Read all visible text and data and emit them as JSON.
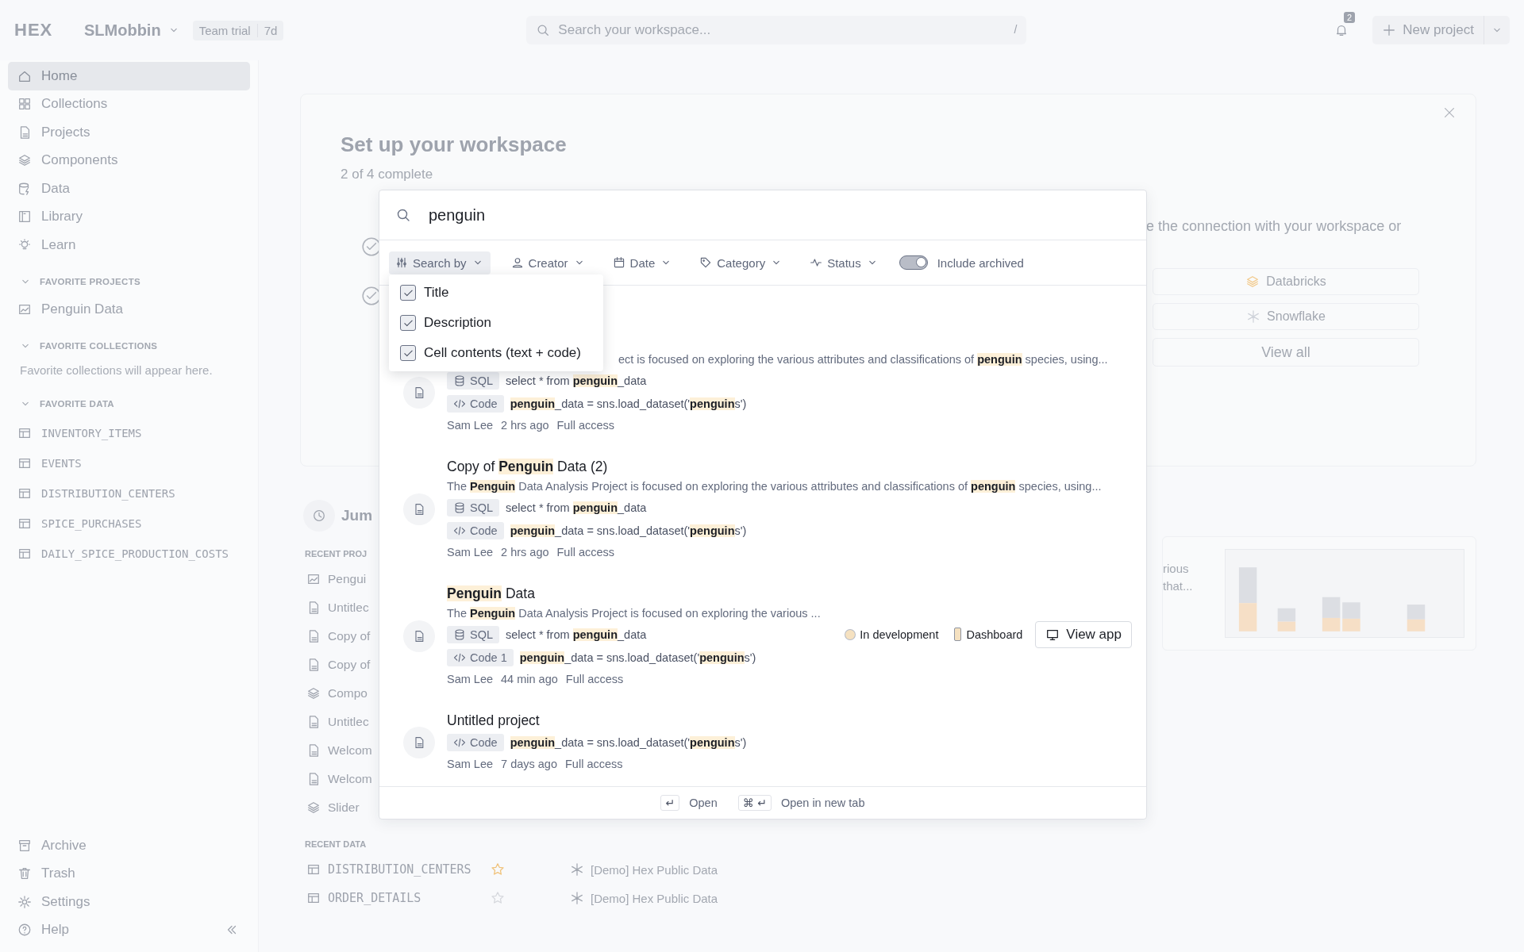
{
  "topbar": {
    "logo": "HEX",
    "workspace": "SLMobbin",
    "plan": "Team trial",
    "plan_days": "7d",
    "search_placeholder": "Search your workspace...",
    "search_shortcut": "/",
    "notifications": "2",
    "new_project": "New project"
  },
  "sidebar": {
    "items": [
      {
        "label": "Home",
        "kind": "home",
        "selected": true
      },
      {
        "label": "Collections",
        "kind": "grid",
        "selected": false
      },
      {
        "label": "Projects",
        "kind": "file",
        "selected": false
      },
      {
        "label": "Components",
        "kind": "layers",
        "selected": false
      },
      {
        "label": "Data",
        "kind": "data",
        "selected": false
      },
      {
        "label": "Library",
        "kind": "book",
        "selected": false
      },
      {
        "label": "Learn",
        "kind": "bulb",
        "selected": false
      }
    ],
    "sections": [
      {
        "title": "FAVORITE PROJECTS",
        "kind": "project",
        "items": [
          {
            "label": "Penguin Data",
            "kind": "chart"
          }
        ]
      },
      {
        "title": "FAVORITE COLLECTIONS",
        "kind": "empty",
        "note": "Favorite collections will appear here."
      },
      {
        "title": "FAVORITE DATA",
        "kind": "data",
        "items": [
          {
            "label": "INVENTORY_ITEMS",
            "kind": "table"
          },
          {
            "label": "EVENTS",
            "kind": "table"
          },
          {
            "label": "DISTRIBUTION_CENTERS",
            "kind": "table"
          },
          {
            "label": "SPICE_PURCHASES",
            "kind": "table"
          },
          {
            "label": "DAILY_SPICE_PRODUCTION_COSTS",
            "kind": "table"
          }
        ]
      }
    ],
    "bottom": [
      {
        "label": "Archive",
        "kind": "archive"
      },
      {
        "label": "Trash",
        "kind": "trash"
      },
      {
        "label": "Settings",
        "kind": "gear"
      },
      {
        "label": "Help",
        "kind": "help"
      }
    ]
  },
  "setup": {
    "title": "Set up your workspace",
    "progress": "2 of 4 complete",
    "steps": [
      {
        "done": true
      },
      {
        "done": true
      }
    ],
    "connection_text": "e the connection with your workspace or",
    "buttons": [
      {
        "label": "Databricks",
        "kind": "layers",
        "color": "#f2c98a"
      },
      {
        "label": "Snowflake",
        "kind": "snowflake",
        "color": "#cfd3da"
      },
      {
        "label": "View all"
      }
    ]
  },
  "jump": {
    "title": "Jum",
    "recent_projects_label": "RECENT PROJ",
    "recent_projects": [
      {
        "label": "Pengui",
        "kind": "chart"
      },
      {
        "label": "Untitlec",
        "kind": "file"
      },
      {
        "label": "Copy of",
        "kind": "file"
      },
      {
        "label": "Copy of",
        "kind": "file"
      },
      {
        "label": "Compo",
        "kind": "layers"
      },
      {
        "label": "Untitlec",
        "kind": "file"
      },
      {
        "label": "Welcom",
        "kind": "file"
      },
      {
        "label": "Welcom",
        "kind": "file"
      },
      {
        "label": "Slider",
        "kind": "layers"
      }
    ],
    "recent_data_label": "RECENT DATA",
    "recent_data": [
      {
        "name": "DISTRIBUTION_CENTERS",
        "starred": true,
        "source": "[Demo] Hex Public Data"
      },
      {
        "name": "ORDER_DETAILS",
        "starred": false,
        "source": "[Demo] Hex Public Data"
      }
    ],
    "preview_text": [
      "rious",
      "that..."
    ]
  },
  "modal": {
    "query": "penguin",
    "filters": [
      {
        "label": "Search by",
        "kind": "sliders",
        "selected": true
      },
      {
        "label": "Creator",
        "kind": "user",
        "selected": false
      },
      {
        "label": "Date",
        "kind": "calendar",
        "selected": false
      },
      {
        "label": "Category",
        "kind": "tag",
        "selected": false
      },
      {
        "label": "Status",
        "kind": "pulse",
        "selected": false
      }
    ],
    "toggle": {
      "label": "Include archived",
      "on": true
    },
    "menu": [
      {
        "label": "Title",
        "checked": true
      },
      {
        "label": "Description",
        "checked": true
      },
      {
        "label": "Cell contents (text + code)",
        "checked": true
      }
    ],
    "results": [
      {
        "clipped": true,
        "description": "ect is focused on exploring the various attributes and classifications of **penguin** species, using...",
        "snippets": [
          {
            "kind": "sql",
            "tag": "SQL",
            "text": "select * from **penguin**_data"
          },
          {
            "kind": "code",
            "tag": "Code",
            "text": "**penguin**_data = sns.load_dataset('**penguin**s')"
          }
        ],
        "author": "Sam Lee",
        "time": "2 hrs ago",
        "access": "Full access"
      },
      {
        "clipped": false,
        "title": "Copy of **Penguin** Data (2)",
        "description": "The **Penguin** Data Analysis Project is focused on exploring the various attributes and classifications of **penguin** species, using...",
        "snippets": [
          {
            "kind": "sql",
            "tag": "SQL",
            "text": "select * from **penguin**_data"
          },
          {
            "kind": "code",
            "tag": "Code",
            "text": "**penguin**_data = sns.load_dataset('**penguin**s')"
          }
        ],
        "author": "Sam Lee",
        "time": "2 hrs ago",
        "access": "Full access"
      },
      {
        "clipped": false,
        "title": "**Penguin** Data",
        "description": "The **Penguin** Data Analysis Project is focused on exploring the various ...",
        "snippets": [
          {
            "kind": "sql",
            "tag": "SQL",
            "text": "select * from **penguin**_data"
          },
          {
            "kind": "code",
            "tag": "Code 1",
            "text": "**penguin**_data = sns.load_dataset('**penguin**s')"
          }
        ],
        "status": {
          "label": "In development",
          "color": "#f5e1c0"
        },
        "category": "Dashboard",
        "action": "View app",
        "author": "Sam Lee",
        "time": "44 min ago",
        "access": "Full access"
      },
      {
        "clipped": false,
        "title": "Untitled project",
        "snippets": [
          {
            "kind": "code",
            "tag": "Code",
            "text": "**penguin**_data = sns.load_dataset('**penguin**s')"
          }
        ],
        "author": "Sam Lee",
        "time": "7 days ago",
        "access": "Full access"
      }
    ],
    "footer": [
      {
        "keys": "↵",
        "label": "Open"
      },
      {
        "keys": "⌘ ↵",
        "label": "Open in new tab"
      }
    ]
  }
}
